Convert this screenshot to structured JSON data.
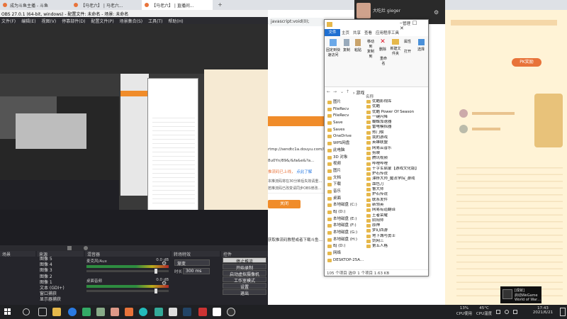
{
  "browser_tabs": [
    {
      "title": "成为斗鱼主播 - 斗鱼"
    },
    {
      "title": "【马老六】 | 马老六..."
    },
    {
      "title": "【马老六】 | 直播间..."
    }
  ],
  "new_tab_icon": "plus-icon",
  "obs": {
    "window_title": "OBS 27.0.1 (64-bit, windows) - 配置文件: 未命名 - 场景: 未命名",
    "menu": [
      "文件(F)",
      "编辑(E)",
      "视图(V)",
      "停靠部件(D)",
      "配置文件(P)",
      "场景集合(S)",
      "工具(T)",
      "帮助(H)"
    ],
    "docks": {
      "scenes_header": "场景",
      "sources_header": "来源",
      "mixer_header": "混音器",
      "transitions_header": "转场特效",
      "controls_header": "控件"
    },
    "sources": [
      "图像 5",
      "图像 4",
      "图像 3",
      "图像 2",
      "图像 1",
      "文本 (GDI+)",
      "窗口捕获",
      "显示器捕获",
      "显示捕获"
    ],
    "mixer": [
      {
        "name": "麦克风/Aux",
        "level": "0.0 dB"
      },
      {
        "name": "桌面音频",
        "level": "0.0 dB"
      }
    ],
    "transition": {
      "mode": "渐变",
      "duration_label": "时长",
      "duration": "300 ms"
    },
    "controls": [
      "停止推流",
      "开始录制",
      "启动虚拟摄像机",
      "工作室模式",
      "设置",
      "退出"
    ],
    "control_active": "停止推流"
  },
  "web_page": {
    "address": "javascript:void(0);",
    "rtmp_label": "rtmp://sendtc1a.douyu.com/live",
    "stream_key": "8u0Yn/89&/&fa&e&?a...",
    "warning": "推流码已上线，",
    "warning_link": "点此了解",
    "notice1": "本推流码将在30分钟后失效请重新获取推流码",
    "notice2": "若推流码已改变请同步OBS修改推流码",
    "button": "关闭",
    "footer": "获取推流码教程或者下载斗鱼直播伴侣"
  },
  "explorer": {
    "title_tabs": [
      "文件",
      "主页",
      "共享",
      "查看",
      "应用程序工具"
    ],
    "ribbon_tab_manage": "管理",
    "path": "游戏",
    "ribbon_buttons": [
      "固定到快速访问",
      "复制",
      "粘贴",
      "移动到",
      "复制到",
      "删除",
      "重命名",
      "新建文件夹",
      "属性",
      "打开",
      "选择"
    ],
    "nav": [
      "图片",
      "FileRecv",
      "FileRecv",
      "Save",
      "Saves",
      "OneDrive",
      "WPS网盘",
      "此电脑",
      "3D 对象",
      "视频",
      "图片",
      "文档",
      "下载",
      "音乐",
      "桌面",
      "本地磁盘 (C:)",
      "BJ (D:)",
      "本地磁盘 (E:)",
      "本地磁盘 (F:)",
      "本地磁盘 (G:)",
      "本地磁盘 (H:)",
      "BJ (D:)",
      "网络",
      "DESKTOP-25A..."
    ],
    "list_header": "名称",
    "files": [
      "优酷影视库",
      "优酷",
      "优酷 Power Of Season",
      "一键闪降",
      "蝴蝶加速器",
      "雷电模拟器",
      "热门榜",
      "我的游戏",
      "英雄联盟",
      "网易云音乐",
      "剪映",
      "腾讯视频",
      "哔哩哔哩",
      "十字军启蒙【游戏文化版】",
      "炉石传说",
      "漂移大师_魔法学院_游戏",
      "血色刀",
      "鲁大师",
      "炉石传说",
      "联系发件",
      "新领英",
      "网易有道翻译",
      "王者荣耀",
      "阴阳师",
      "原神",
      "梦幻西游",
      "地下城与勇士",
      "剑网三",
      "第五人格"
    ],
    "status": "105 个项目    选中 1 个项目  1.63 KB"
  },
  "stream_window": {
    "name": "大吃灶 gieger"
  },
  "side_page": {
    "gift_badge": "PK奖励"
  },
  "toast": {
    "line1": "[成就]",
    "line2": "启动WeGame",
    "line3": "World of Warships"
  },
  "tray": {
    "cpu_percent": "13%",
    "cpu_label": "CPU使用",
    "temp": "45°C",
    "temp_label": "CPU温度",
    "time": "17:43",
    "date": "2021/6/21"
  },
  "taskbar_icons": [
    "windows-icon",
    "search-icon",
    "task-view-icon",
    "file-explorer-icon",
    "chrome-icon",
    "edge-icon",
    "store-icon",
    "steam-icon",
    "wechat-icon",
    "obs-icon",
    "folder-icon",
    "qq-icon",
    "app-icon",
    "app-icon"
  ]
}
